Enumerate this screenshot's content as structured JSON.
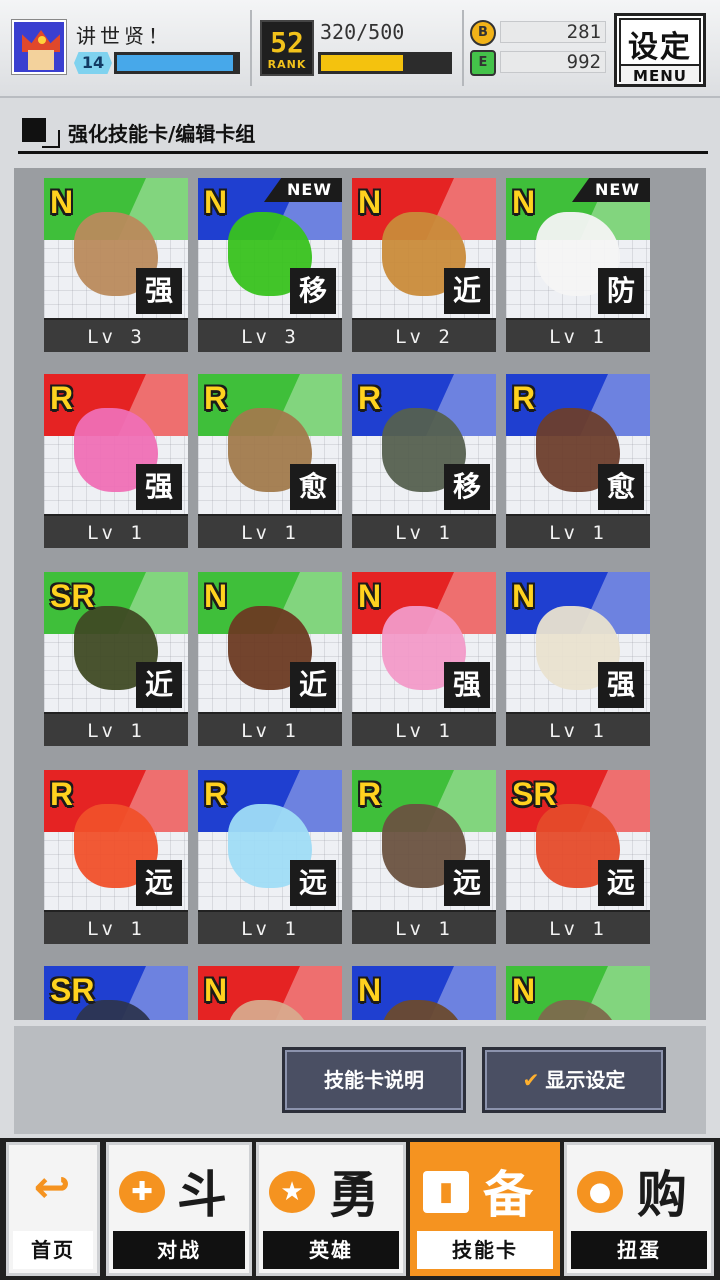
{
  "header": {
    "username": "讲世贤！",
    "player_level": "14",
    "exp_fraction": 0.97,
    "rank_number": "52",
    "rank_label": "RANK",
    "rank_progress_text": "320/500",
    "rank_fraction": 0.64,
    "coin_gold_icon": "B",
    "coin_gold": "281",
    "coin_green_icon": "E",
    "coin_green": "992",
    "menu_cn": "设定",
    "menu_en": "MENU"
  },
  "section": {
    "title": "强化技能卡/编辑卡组"
  },
  "cards": [
    {
      "rarity": "N",
      "band": "green",
      "type": "强",
      "level": "Lv 3",
      "new": "",
      "obj_color": "#b98a5c"
    },
    {
      "rarity": "N",
      "band": "blue",
      "type": "移",
      "level": "Lv 3",
      "new": "NEW",
      "obj_color": "#38c21e"
    },
    {
      "rarity": "N",
      "band": "red",
      "type": "近",
      "level": "Lv 2",
      "new": "",
      "obj_color": "#c98b3a"
    },
    {
      "rarity": "N",
      "band": "green",
      "type": "防",
      "level": "Lv 1",
      "new": "NEW",
      "obj_color": "#f4f4f4"
    },
    {
      "rarity": "R",
      "band": "red",
      "type": "强",
      "level": "Lv 1",
      "new": "",
      "obj_color": "#ef6fb5"
    },
    {
      "rarity": "R",
      "band": "green",
      "type": "愈",
      "level": "Lv 1",
      "new": "",
      "obj_color": "#a17a4c"
    },
    {
      "rarity": "R",
      "band": "blue",
      "type": "移",
      "level": "Lv 1",
      "new": "",
      "obj_color": "#55604f"
    },
    {
      "rarity": "R",
      "band": "blue",
      "type": "愈",
      "level": "Lv 1",
      "new": "",
      "obj_color": "#6d3e2c"
    },
    {
      "rarity": "SR",
      "band": "green",
      "type": "近",
      "level": "Lv 1",
      "new": "",
      "obj_color": "#3f4a24"
    },
    {
      "rarity": "N",
      "band": "green",
      "type": "近",
      "level": "Lv 1",
      "new": "",
      "obj_color": "#6b3a22"
    },
    {
      "rarity": "N",
      "band": "red",
      "type": "强",
      "level": "Lv 1",
      "new": "",
      "obj_color": "#f29ac8"
    },
    {
      "rarity": "N",
      "band": "blue",
      "type": "强",
      "level": "Lv 1",
      "new": "",
      "obj_color": "#e9e2cf"
    },
    {
      "rarity": "R",
      "band": "red",
      "type": "远",
      "level": "Lv 1",
      "new": "",
      "obj_color": "#f0502a"
    },
    {
      "rarity": "R",
      "band": "blue",
      "type": "远",
      "level": "Lv 1",
      "new": "",
      "obj_color": "#9fdcf5"
    },
    {
      "rarity": "R",
      "band": "green",
      "type": "远",
      "level": "Lv 1",
      "new": "",
      "obj_color": "#6a5240"
    },
    {
      "rarity": "SR",
      "band": "red",
      "type": "远",
      "level": "Lv 1",
      "new": "",
      "obj_color": "#e54b2a"
    },
    {
      "rarity": "SR",
      "band": "blue",
      "type": "",
      "level": "",
      "new": "",
      "obj_color": "#2d3550"
    },
    {
      "rarity": "N",
      "band": "red",
      "type": "",
      "level": "",
      "new": "",
      "obj_color": "#d8a98c"
    },
    {
      "rarity": "N",
      "band": "blue",
      "type": "",
      "level": "",
      "new": "",
      "obj_color": "#6b4a2e"
    },
    {
      "rarity": "N",
      "band": "green",
      "type": "",
      "level": "",
      "new": "",
      "obj_color": "#7d6a4d"
    }
  ],
  "actions": {
    "explain_label": "技能卡说明",
    "display_label": "显示设定",
    "display_check": "✔"
  },
  "nav": [
    {
      "key": "home",
      "label": "首页",
      "big": "",
      "glyph": "↩",
      "active": false
    },
    {
      "key": "battle",
      "label": "对战",
      "big": "斗",
      "glyph": "✚",
      "active": false
    },
    {
      "key": "hero",
      "label": "英雄",
      "big": "勇",
      "glyph": "★",
      "active": false
    },
    {
      "key": "skillcard",
      "label": "技能卡",
      "big": "备",
      "glyph": "▮",
      "active": true
    },
    {
      "key": "gacha",
      "label": "扭蛋",
      "big": "购",
      "glyph": "●",
      "active": false
    }
  ]
}
